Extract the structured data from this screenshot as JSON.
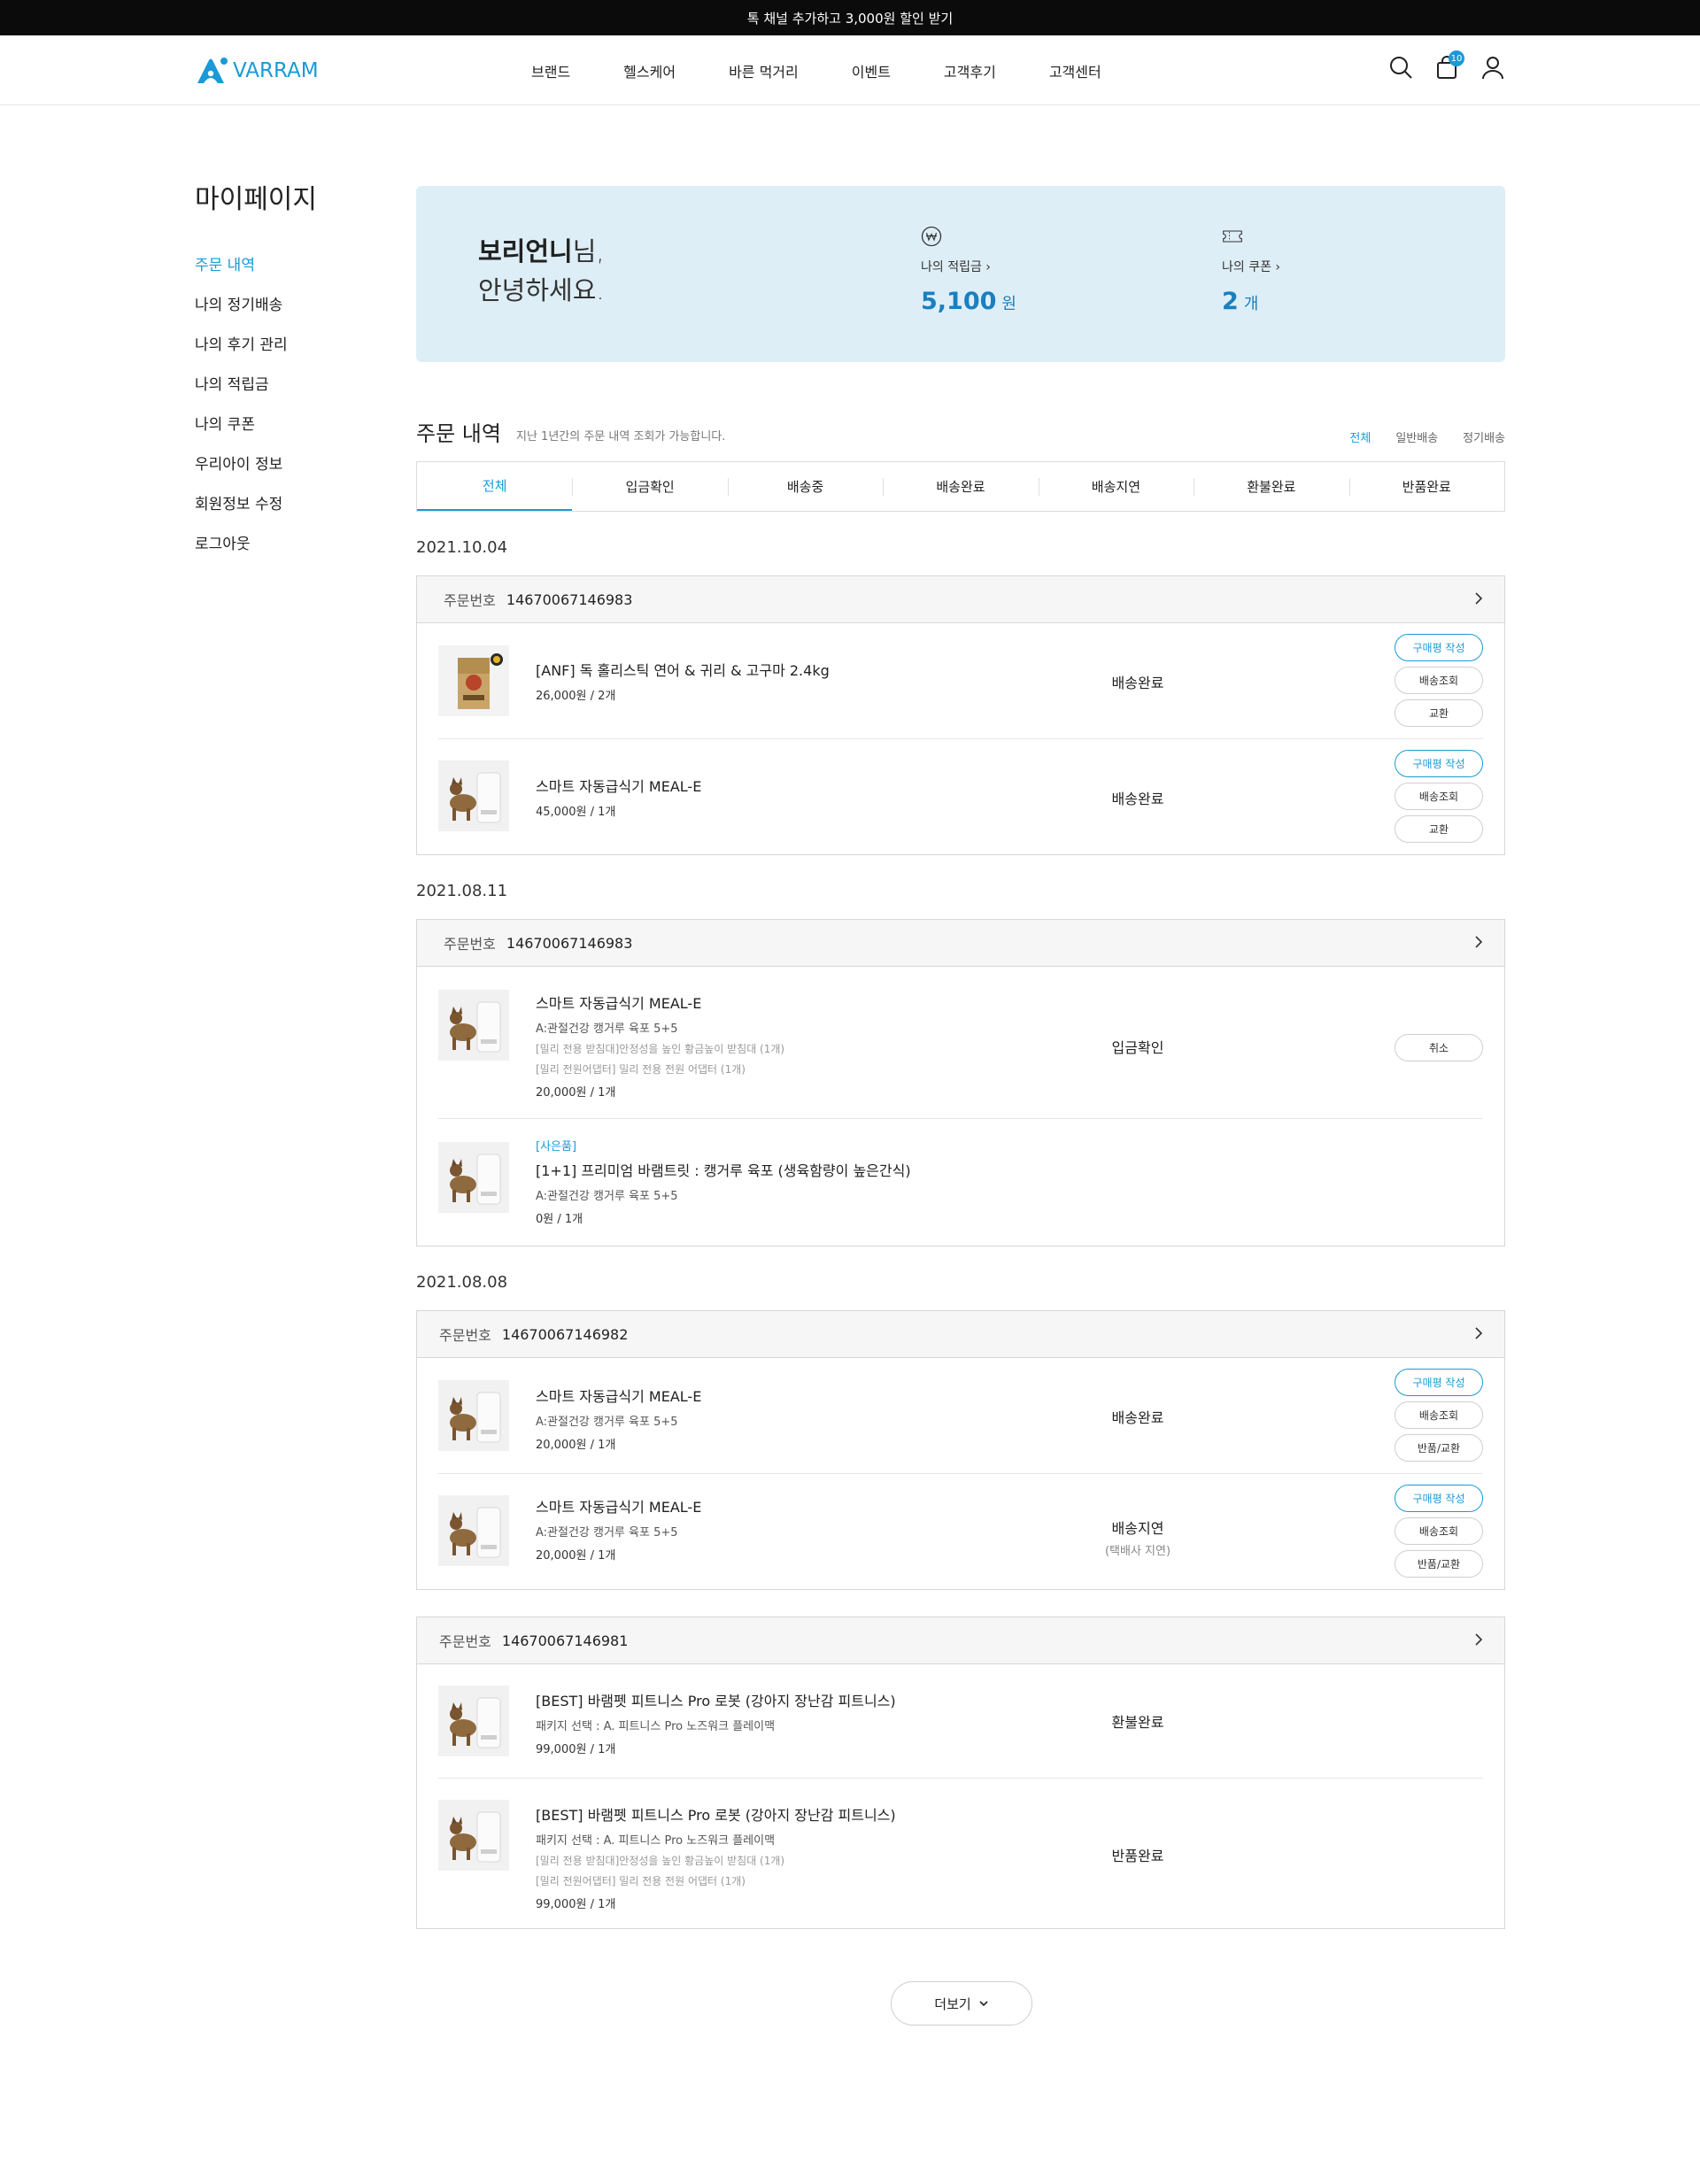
{
  "topbar": {
    "text": "톡 채널 추가하고 3,000원 할인 받기"
  },
  "header": {
    "logo_text": "VARRAM",
    "nav": [
      "브랜드",
      "헬스케어",
      "바른 먹거리",
      "이벤트",
      "고객후기",
      "고객센터"
    ],
    "cart_count": "10"
  },
  "sidebar": {
    "title": "마이페이지",
    "items": [
      "주문 내역",
      "나의 정기배송",
      "나의 후기 관리",
      "나의 적립금",
      "나의 쿠폰",
      "우리아이 정보",
      "회원정보 수정",
      "로그아웃"
    ]
  },
  "summary": {
    "name": "보리언니",
    "name_suffix": "님,",
    "greeting": "안녕하세요.",
    "points_label": "나의 적립금",
    "points_value": "5,100",
    "points_unit": "원",
    "coupon_label": "나의 쿠폰",
    "coupon_value": "2",
    "coupon_unit": "개"
  },
  "orders_section": {
    "title": "주문 내역",
    "desc": "지난 1년간의 주문 내역 조회가 가능합니다.",
    "filters": [
      "전체",
      "일반배송",
      "정기배송"
    ],
    "tabs": [
      "전체",
      "입금확인",
      "배송중",
      "배송완료",
      "배송지연",
      "환불완료",
      "반품완료"
    ],
    "order_no_label": "주문번호",
    "more_label": "더보기"
  },
  "groups": [
    {
      "date": "2021.10.04",
      "order_no": "14670067146983",
      "items": [
        {
          "name": "[ANF] 독 홀리스틱 연어 & 귀리 & 고구마  2.4kg",
          "price": "26,000원 / 2개",
          "status": "배송완료",
          "buttons": [
            "구매평 작성",
            "배송조회",
            "교환"
          ]
        },
        {
          "name": "스마트 자동급식기 MEAL-E",
          "price": "45,000원 / 1개",
          "status": "배송완료",
          "buttons": [
            "구매평 작성",
            "배송조회",
            "교환"
          ]
        }
      ]
    },
    {
      "date": "2021.08.11",
      "order_no": "14670067146983",
      "items": [
        {
          "name": "스마트 자동급식기 MEAL-E",
          "option": "A:관절건강 캥거루 육포 5+5",
          "extra1": "[밀리 전용 받침대]안정성을 높인 황금높이 받침대 (1개)",
          "extra2": "[밀리 전원어댑터] 밀리 전용 전원 어댑터 (1개)",
          "price": "20,000원 / 1개",
          "status": "입금확인",
          "buttons": [
            "취소"
          ]
        },
        {
          "gift": "[사은품]",
          "name": "[1+1] 프리미엄 바램트릿 : 캥거루 육포 (생육함량이 높은간식)",
          "option": "A:관절건강 캥거루 육포 5+5",
          "price": "0원 / 1개"
        }
      ]
    },
    {
      "date": "2021.08.08",
      "order_no": "14670067146982",
      "items": [
        {
          "name": "스마트 자동급식기 MEAL-E",
          "option": "A:관절건강 캥거루 육포 5+5",
          "price": "20,000원 / 1개",
          "status": "배송완료",
          "buttons": [
            "구매평 작성",
            "배송조회",
            "반품/교환"
          ]
        },
        {
          "name": "스마트 자동급식기 MEAL-E",
          "option": "A:관절건강 캥거루 육포 5+5",
          "price": "20,000원 / 1개",
          "status": "배송지연",
          "status_sub": "(택배사 지연)",
          "buttons": [
            "구매평 작성",
            "배송조회",
            "반품/교환"
          ]
        }
      ]
    },
    {
      "order_no": "14670067146981",
      "items": [
        {
          "name": "[BEST] 바램펫 피트니스 Pro 로봇 (강아지 장난감 피트니스)",
          "option": "패키지 선택 : A.  피트니스 Pro 노즈워크 플레이맥",
          "price": "99,000원 / 1개",
          "status": "환불완료"
        },
        {
          "name": "[BEST] 바램펫 피트니스 Pro 로봇 (강아지 장난감 피트니스)",
          "option": "패키지 선택 : A.  피트니스 Pro 노즈워크 플레이맥",
          "extra1": "[밀리 전용 받침대]안정성을 높인 황금높이 받침대 (1개)",
          "extra2": "[밀리 전원어댑터] 밀리 전용 전원 어댑터 (1개)",
          "price": "99,000원 / 1개",
          "status": "반품완료"
        }
      ]
    }
  ],
  "colors": {
    "accent": "#1a9ad6",
    "summary_bg": "#deeef7",
    "topbar_bg": "#0b0b0b"
  }
}
